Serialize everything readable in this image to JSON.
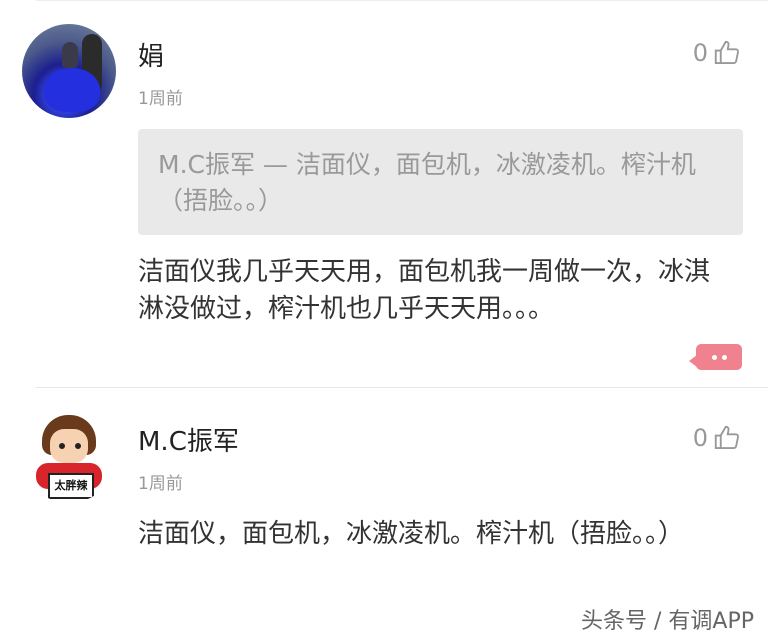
{
  "comments": [
    {
      "author": "娟",
      "time": "1周前",
      "likes": "0",
      "quote": "M.C振军  — 洁面仪，面包机，冰激凌机。榨汁机（捂脸。。）",
      "body": "洁面仪我几乎天天用，面包机我一周做一次，冰淇淋没做过，榨汁机也几乎天天用。。。"
    },
    {
      "author": "M.C振军",
      "time": "1周前",
      "likes": "0",
      "avatar_sign": "太胖辣",
      "body": "洁面仪，面包机，冰激凌机。榨汁机（捂脸。。）"
    }
  ],
  "watermark": "头条号 / 有调APP",
  "icons": {
    "like": "thumbs-up-outline-icon",
    "reply": "speech-bubble-icon"
  },
  "colors": {
    "accent": "#f0828f",
    "quote_bg": "#e9e9e9",
    "meta_text": "#999999"
  }
}
